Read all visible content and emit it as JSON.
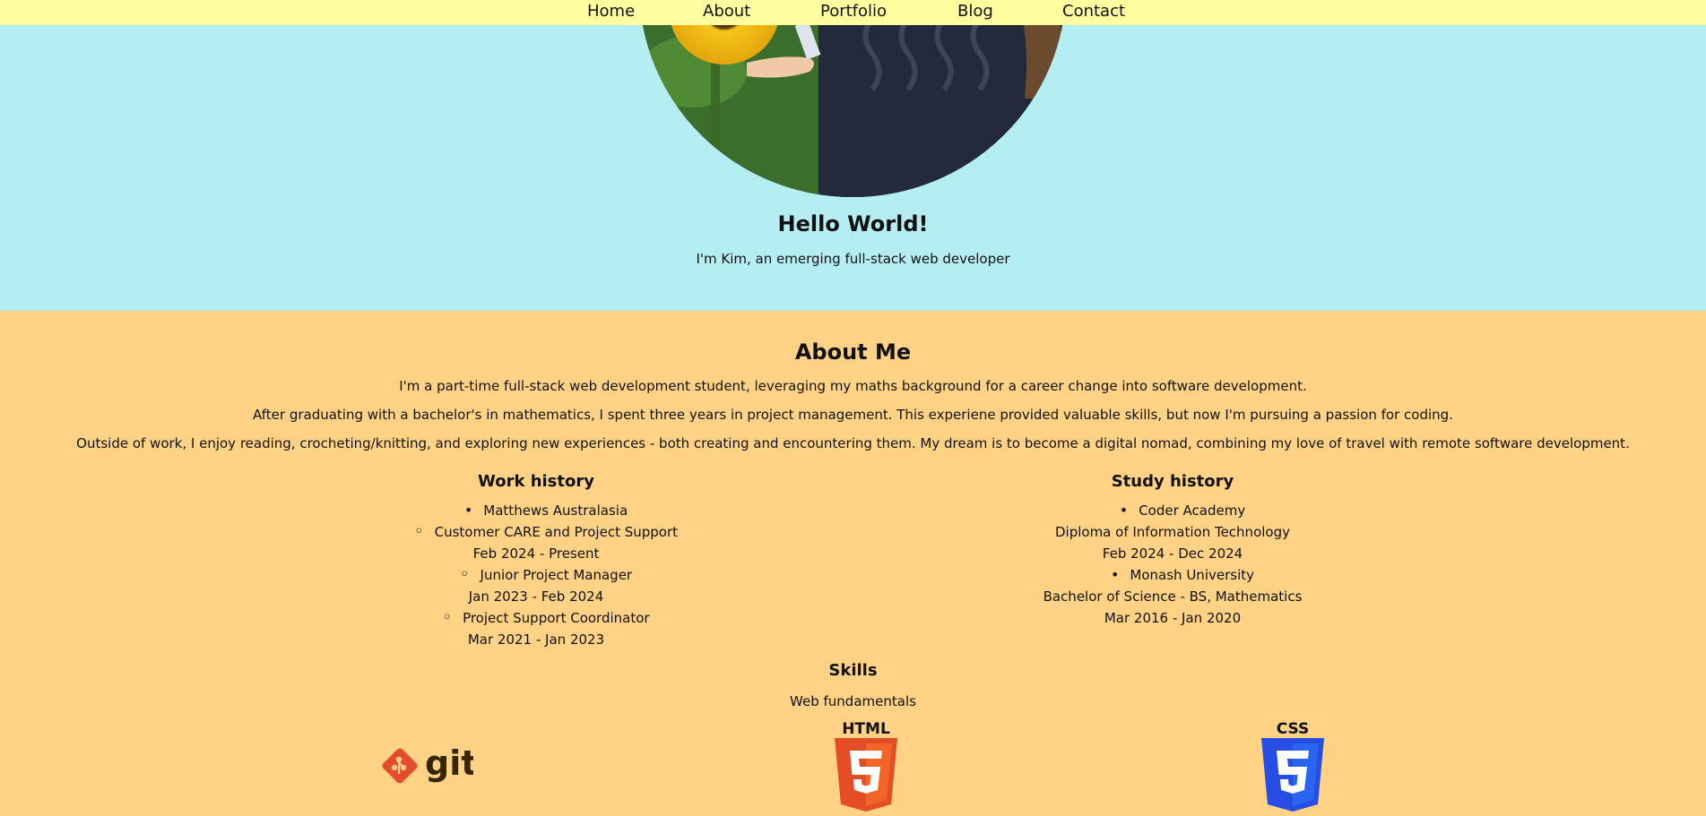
{
  "nav": {
    "items": [
      {
        "label": "Home"
      },
      {
        "label": "About"
      },
      {
        "label": "Portfolio"
      },
      {
        "label": "Blog"
      },
      {
        "label": "Contact"
      }
    ]
  },
  "hero": {
    "title": "Hello World!",
    "subtitle": "I'm Kim, an emerging full-stack web developer"
  },
  "about": {
    "title": "About Me",
    "paragraphs": [
      "I'm a part-time full-stack web development student, leveraging my maths background for a career change into software development.",
      "After graduating with a bachelor's in mathematics, I spent three years in project management. This experiene provided valuable skills, but now I'm pursuing a passion for coding.",
      "Outside of work, I enjoy reading, crocheting/knitting, and exploring new experiences - both creating and encountering them. My dream is to become a digital nomad, combining my love of travel with remote software development."
    ]
  },
  "work": {
    "title": "Work history",
    "company": "Matthews Australasia",
    "roles": [
      {
        "title": "Customer CARE and Project Support",
        "dates": "Feb 2024 - Present"
      },
      {
        "title": "Junior Project Manager",
        "dates": "Jan 2023 - Feb 2024"
      },
      {
        "title": "Project Support Coordinator",
        "dates": "Mar 2021 - Jan 2023"
      }
    ]
  },
  "study": {
    "title": "Study history",
    "items": [
      {
        "school": "Coder Academy",
        "degree": "Diploma of Information Technology",
        "dates": "Feb 2024 - Dec 2024"
      },
      {
        "school": "Monash University",
        "degree": "Bachelor of Science - BS, Mathematics",
        "dates": "Mar 2016 - Jan 2020"
      }
    ]
  },
  "skills": {
    "title": "Skills",
    "subtitle": "Web fundamentals",
    "logos": [
      {
        "name": "git",
        "text": "git"
      },
      {
        "name": "html",
        "text": "HTML"
      },
      {
        "name": "css",
        "text": "CSS"
      }
    ]
  },
  "colors": {
    "nav_bg": "#ffff9f",
    "hero_bg": "#b5eef2",
    "about_bg": "#ffd285",
    "git_orange": "#e44c30",
    "html_orange": "#e44d26",
    "css_blue": "#264de4"
  }
}
